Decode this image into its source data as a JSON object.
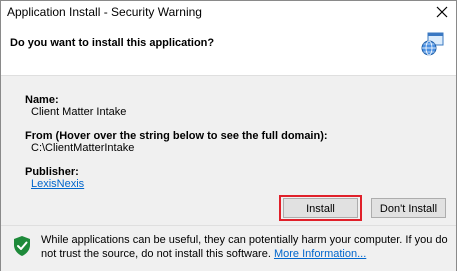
{
  "window": {
    "title": "Application Install - Security Warning"
  },
  "header": {
    "question": "Do you want to install this application?"
  },
  "details": {
    "name_label": "Name:",
    "name_value": "Client Matter Intake",
    "from_label": "From (Hover over the string below to see the full domain):",
    "from_value": "C:\\ClientMatterIntake",
    "publisher_label": "Publisher:",
    "publisher_value": "LexisNexis"
  },
  "buttons": {
    "install": "Install",
    "dont_install": "Don't Install"
  },
  "footer": {
    "warning_text": "While applications can be useful, they can potentially harm your computer. If you do not trust the source, do not install this software.",
    "more_info": "More Information..."
  },
  "colors": {
    "highlight": "#e0202a",
    "link": "#0066cc",
    "shield": "#1e8a3a"
  }
}
